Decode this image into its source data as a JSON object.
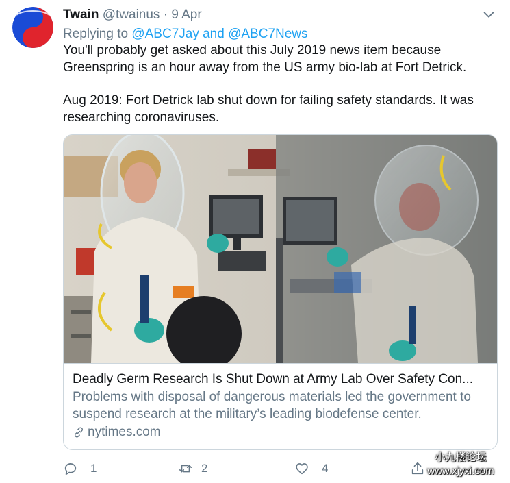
{
  "tweet": {
    "author": {
      "name": "Twain",
      "handle": "@twainus",
      "avatar_icon": "yin-yang-icon"
    },
    "separator": "·",
    "timestamp": "9 Apr",
    "reply": {
      "prefix": "Replying to",
      "mentions": "@ABC7Jay and @ABC7News"
    },
    "text": {
      "paragraph1": "You'll probably get asked about this July 2019 news item because Greenspring is an hour away from the US army bio-lab at Fort Detrick.",
      "paragraph2": "Aug 2019: Fort Detrick lab shut down for failing safety standards. It was researching coronaviruses."
    }
  },
  "card": {
    "title": "Deadly Germ Research Is Shut Down at Army Lab Over Safety Con...",
    "description": "Problems with disposal of dangerous materials led the government to suspend research at the military’s leading biodefense center.",
    "domain": "nytimes.com"
  },
  "actions": {
    "replies": "1",
    "retweets": "2",
    "likes": "4"
  },
  "watermark": {
    "line1": "小九楼论坛",
    "line2": "www.xjyxi.com"
  },
  "colors": {
    "primary_text": "#14171a",
    "secondary_text": "#657786",
    "link": "#1da1f2",
    "border": "#ccd6dd",
    "avatar_red": "#e0242d",
    "avatar_blue": "#1a4bd6"
  }
}
